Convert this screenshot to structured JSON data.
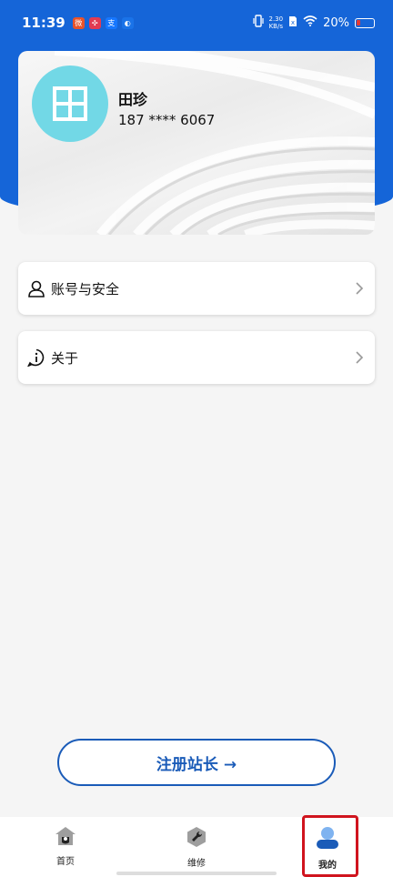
{
  "status_bar": {
    "time": "11:39",
    "app_badges": [
      {
        "name": "app-badge-1",
        "glyph": "微",
        "color": "#e8532b"
      },
      {
        "name": "app-badge-2",
        "glyph": "✣",
        "color": "#e23b52"
      },
      {
        "name": "app-badge-3",
        "glyph": "支",
        "color": "#1677ff"
      },
      {
        "name": "app-badge-4",
        "glyph": "◐",
        "color": "#1a73e8"
      }
    ],
    "net_speed_value": "2.30",
    "net_speed_unit": "KB/s",
    "battery_percent": "20%"
  },
  "profile": {
    "name": "田珍",
    "phone": "187 **** 6067",
    "avatar_color": "#72d8e6"
  },
  "menu": {
    "items": [
      {
        "label": "账号与安全",
        "icon": "user-outline-icon"
      },
      {
        "label": "关于",
        "icon": "info-circle-icon"
      }
    ]
  },
  "actions": {
    "register_label": "注册站长 →"
  },
  "tab_bar": {
    "tabs": [
      {
        "label": "首页",
        "icon": "home-icon",
        "active": false
      },
      {
        "label": "维修",
        "icon": "wrench-icon",
        "active": false
      },
      {
        "label": "我的",
        "icon": "profile-icon",
        "active": true
      }
    ]
  },
  "colors": {
    "brand_blue": "#1565d8",
    "button_blue": "#1a5bb8",
    "highlight_red": "#d0141e"
  }
}
